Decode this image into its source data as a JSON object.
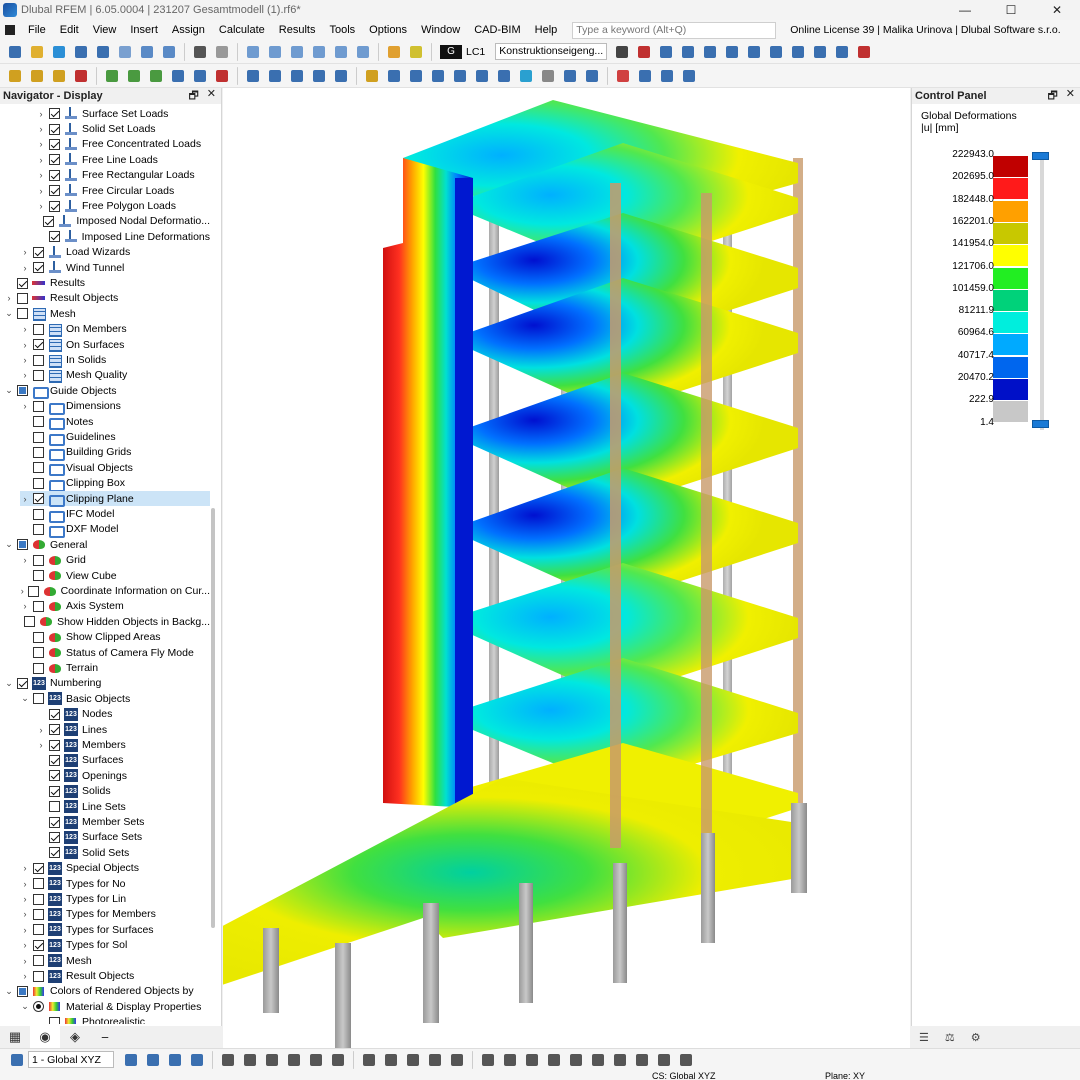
{
  "window": {
    "title": "Dlubal RFEM | 6.05.0004 | 231207 Gesamtmodell (1).rf6*",
    "minimize": "—",
    "maximize": "☐",
    "close": "✕"
  },
  "menu": {
    "items": [
      "File",
      "Edit",
      "View",
      "Insert",
      "Assign",
      "Calculate",
      "Results",
      "Tools",
      "Options",
      "Window",
      "CAD-BIM",
      "Help"
    ],
    "search_placeholder": "Type a keyword (Alt+Q)",
    "license": "Online License 39 | Malika Urinova | Dlubal Software s.r.o."
  },
  "toolbar": {
    "loadcase_type": "G",
    "loadcase": "LC1",
    "loadcase_name": "Konstruktionseigeng..."
  },
  "navigator": {
    "title": "Navigator - Display",
    "pin": "🗗",
    "close": "✕",
    "items": [
      {
        "label": "Surface Set Loads",
        "level": 2,
        "arrow": "›",
        "check": "on",
        "icon": "load"
      },
      {
        "label": "Solid Set Loads",
        "level": 2,
        "arrow": "›",
        "check": "on",
        "icon": "load"
      },
      {
        "label": "Free Concentrated Loads",
        "level": 2,
        "arrow": "›",
        "check": "on",
        "icon": "load"
      },
      {
        "label": "Free Line Loads",
        "level": 2,
        "arrow": "›",
        "check": "on",
        "icon": "load"
      },
      {
        "label": "Free Rectangular Loads",
        "level": 2,
        "arrow": "›",
        "check": "on",
        "icon": "load"
      },
      {
        "label": "Free Circular Loads",
        "level": 2,
        "arrow": "›",
        "check": "on",
        "icon": "load"
      },
      {
        "label": "Free Polygon Loads",
        "level": 2,
        "arrow": "›",
        "check": "on",
        "icon": "load"
      },
      {
        "label": "Imposed Nodal Deformatio...",
        "level": 2,
        "arrow": "",
        "check": "on",
        "icon": "load"
      },
      {
        "label": "Imposed Line Deformations",
        "level": 2,
        "arrow": "",
        "check": "on",
        "icon": "load"
      },
      {
        "label": "Load Wizards",
        "level": 1,
        "arrow": "›",
        "check": "on",
        "icon": "load"
      },
      {
        "label": "Wind Tunnel",
        "level": 1,
        "arrow": "›",
        "check": "on",
        "icon": "load"
      },
      {
        "label": "Results",
        "level": 0,
        "arrow": "",
        "check": "on",
        "icon": "result"
      },
      {
        "label": "Result Objects",
        "level": 0,
        "arrow": "›",
        "check": "off",
        "icon": "result"
      },
      {
        "label": "Mesh",
        "level": 0,
        "arrow": "⌄",
        "check": "off",
        "icon": "mesh"
      },
      {
        "label": "On Members",
        "level": 1,
        "arrow": "›",
        "check": "off",
        "icon": "mesh"
      },
      {
        "label": "On Surfaces",
        "level": 1,
        "arrow": "›",
        "check": "on",
        "icon": "mesh"
      },
      {
        "label": "In Solids",
        "level": 1,
        "arrow": "›",
        "check": "off",
        "icon": "mesh"
      },
      {
        "label": "Mesh Quality",
        "level": 1,
        "arrow": "›",
        "check": "off",
        "icon": "mesh"
      },
      {
        "label": "Guide Objects",
        "level": 0,
        "arrow": "⌄",
        "check": "part",
        "icon": "guide"
      },
      {
        "label": "Dimensions",
        "level": 1,
        "arrow": "›",
        "check": "off",
        "icon": "guide"
      },
      {
        "label": "Notes",
        "level": 1,
        "arrow": "",
        "check": "off",
        "icon": "guide"
      },
      {
        "label": "Guidelines",
        "level": 1,
        "arrow": "",
        "check": "off",
        "icon": "guide"
      },
      {
        "label": "Building Grids",
        "level": 1,
        "arrow": "",
        "check": "off",
        "icon": "guide"
      },
      {
        "label": "Visual Objects",
        "level": 1,
        "arrow": "",
        "check": "off",
        "icon": "guide"
      },
      {
        "label": "Clipping Box",
        "level": 1,
        "arrow": "",
        "check": "off",
        "icon": "guide"
      },
      {
        "label": "Clipping Plane",
        "level": 1,
        "arrow": "›",
        "check": "on",
        "icon": "guide",
        "selected": true
      },
      {
        "label": "IFC Model",
        "level": 1,
        "arrow": "",
        "check": "off",
        "icon": "guide"
      },
      {
        "label": "DXF Model",
        "level": 1,
        "arrow": "",
        "check": "off",
        "icon": "guide"
      },
      {
        "label": "General",
        "level": 0,
        "arrow": "⌄",
        "check": "part",
        "icon": "heart"
      },
      {
        "label": "Grid",
        "level": 1,
        "arrow": "›",
        "check": "off",
        "icon": "heart"
      },
      {
        "label": "View Cube",
        "level": 1,
        "arrow": "",
        "check": "off",
        "icon": "heart"
      },
      {
        "label": "Coordinate Information on Cur...",
        "level": 1,
        "arrow": "›",
        "check": "off",
        "icon": "heart"
      },
      {
        "label": "Axis System",
        "level": 1,
        "arrow": "›",
        "check": "off",
        "icon": "heart"
      },
      {
        "label": "Show Hidden Objects in Backg...",
        "level": 1,
        "arrow": "",
        "check": "off",
        "icon": "heart"
      },
      {
        "label": "Show Clipped Areas",
        "level": 1,
        "arrow": "",
        "check": "off",
        "icon": "heart"
      },
      {
        "label": "Status of Camera Fly Mode",
        "level": 1,
        "arrow": "",
        "check": "off",
        "icon": "heart"
      },
      {
        "label": "Terrain",
        "level": 1,
        "arrow": "",
        "check": "off",
        "icon": "heart"
      },
      {
        "label": "Numbering",
        "level": 0,
        "arrow": "⌄",
        "check": "on",
        "icon": "num"
      },
      {
        "label": "Basic Objects",
        "level": 1,
        "arrow": "⌄",
        "check": "off",
        "icon": "num"
      },
      {
        "label": "Nodes",
        "level": 2,
        "arrow": "",
        "check": "on",
        "icon": "num"
      },
      {
        "label": "Lines",
        "level": 2,
        "arrow": "›",
        "check": "on",
        "icon": "num"
      },
      {
        "label": "Members",
        "level": 2,
        "arrow": "›",
        "check": "on",
        "icon": "num"
      },
      {
        "label": "Surfaces",
        "level": 2,
        "arrow": "",
        "check": "on",
        "icon": "num"
      },
      {
        "label": "Openings",
        "level": 2,
        "arrow": "",
        "check": "on",
        "icon": "num"
      },
      {
        "label": "Solids",
        "level": 2,
        "arrow": "",
        "check": "on",
        "icon": "num"
      },
      {
        "label": "Line Sets",
        "level": 2,
        "arrow": "",
        "check": "off",
        "icon": "num"
      },
      {
        "label": "Member Sets",
        "level": 2,
        "arrow": "",
        "check": "on",
        "icon": "num"
      },
      {
        "label": "Surface Sets",
        "level": 2,
        "arrow": "",
        "check": "on",
        "icon": "num"
      },
      {
        "label": "Solid Sets",
        "level": 2,
        "arrow": "",
        "check": "on",
        "icon": "num"
      },
      {
        "label": "Special Objects",
        "level": 1,
        "arrow": "›",
        "check": "on",
        "icon": "num"
      },
      {
        "label": "Types for No",
        "level": 1,
        "arrow": "›",
        "check": "off",
        "icon": "num"
      },
      {
        "label": "Types for Lin",
        "level": 1,
        "arrow": "›",
        "check": "off",
        "icon": "num"
      },
      {
        "label": "Types for Members",
        "level": 1,
        "arrow": "›",
        "check": "off",
        "icon": "num"
      },
      {
        "label": "Types for Surfaces",
        "level": 1,
        "arrow": "›",
        "check": "off",
        "icon": "num"
      },
      {
        "label": "Types for Sol",
        "level": 1,
        "arrow": "›",
        "check": "on",
        "icon": "num"
      },
      {
        "label": "Mesh",
        "level": 1,
        "arrow": "›",
        "check": "off",
        "icon": "num"
      },
      {
        "label": "Result Objects",
        "level": 1,
        "arrow": "›",
        "check": "off",
        "icon": "num"
      },
      {
        "label": "Colors of Rendered Objects by",
        "level": 0,
        "arrow": "⌄",
        "check": "part",
        "icon": "colors"
      },
      {
        "label": "Material & Display Properties",
        "level": 1,
        "arrow": "⌄",
        "check": "radio-on",
        "icon": "colors"
      },
      {
        "label": "Photorealistic",
        "level": 2,
        "arrow": "",
        "check": "off",
        "icon": "colors"
      }
    ]
  },
  "control_panel": {
    "title": "Control Panel",
    "pin": "🗗",
    "close": "✕",
    "result_title": "Global Deformations",
    "result_unit": "|u| [mm]",
    "legend": [
      {
        "value": "222943.0",
        "color": "#c00000"
      },
      {
        "value": "202695.0",
        "color": "#ff1a1a"
      },
      {
        "value": "182448.0",
        "color": "#ffa000"
      },
      {
        "value": "162201.0",
        "color": "#c8c800"
      },
      {
        "value": "141954.0",
        "color": "#ffff00"
      },
      {
        "value": "121706.0",
        "color": "#22ee22"
      },
      {
        "value": "101459.0",
        "color": "#00d27a"
      },
      {
        "value": "81211.9",
        "color": "#00eedd"
      },
      {
        "value": "60964.6",
        "color": "#00aaff"
      },
      {
        "value": "40717.4",
        "color": "#0066ee"
      },
      {
        "value": "20470.2",
        "color": "#0010c8"
      },
      {
        "value": "222.9",
        "color": "#c8c8c8"
      },
      {
        "value": "1.4",
        "color": ""
      }
    ]
  },
  "statusbar": {
    "view_combo": "1 - Global XYZ",
    "cs": "CS: Global XYZ",
    "plane": "Plane: XY"
  }
}
